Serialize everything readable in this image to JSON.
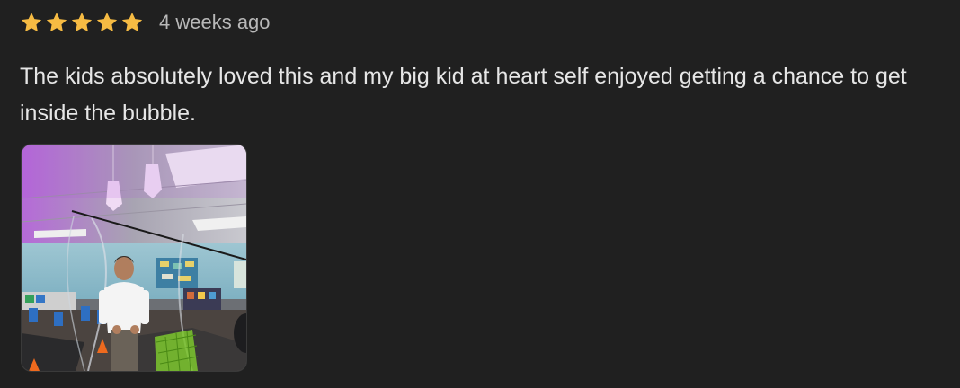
{
  "review": {
    "rating": 5,
    "rating_max": 5,
    "star_color": "#f6bb43",
    "timestamp": "4 weeks ago",
    "text": "The kids absolutely loved this and my big kid at heart self enjoyed getting a chance to get inside the bubble.",
    "photo_icon": "review-photo"
  }
}
